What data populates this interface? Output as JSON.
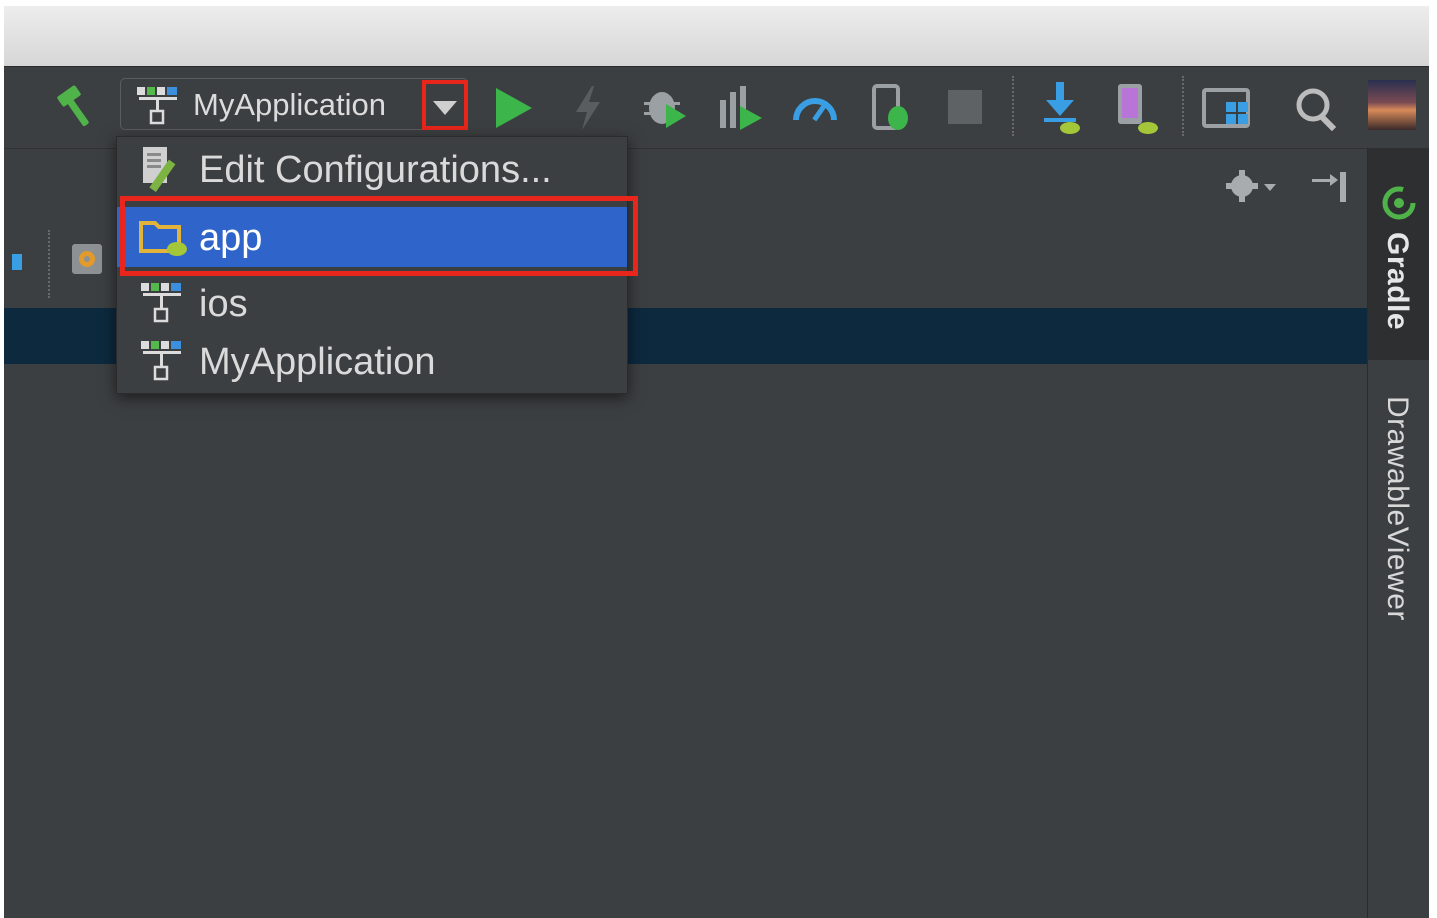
{
  "toolbar": {
    "run_config_label": "MyApplication",
    "icons": [
      "build-hammer-icon",
      "run-config-icon",
      "dropdown-arrow-icon",
      "run-icon",
      "apply-changes-icon",
      "debug-icon",
      "profile-icon",
      "profiler-icon",
      "attach-debugger-icon",
      "stop-icon",
      "sdk-manager-icon",
      "avd-manager-icon",
      "project-structure-icon",
      "search-icon",
      "user-avatar"
    ]
  },
  "dropdown": {
    "items": [
      {
        "label": "Edit Configurations...",
        "icon": "edit-config-icon"
      },
      {
        "label": "app",
        "icon": "android-module-icon",
        "selected": true
      },
      {
        "label": "ios",
        "icon": "run-config-icon"
      },
      {
        "label": "MyApplication",
        "icon": "run-config-icon"
      }
    ]
  },
  "right_sidebar": {
    "tabs": [
      {
        "label": "Gradle",
        "active": true
      },
      {
        "label": "DrawableViewer",
        "active": false
      }
    ]
  },
  "colors": {
    "background": "#3c3f41",
    "selection": "#2f65ca",
    "highlight_box": "#e8261b",
    "selected_row": "#0d293e",
    "run_green": "#3cb54a"
  }
}
